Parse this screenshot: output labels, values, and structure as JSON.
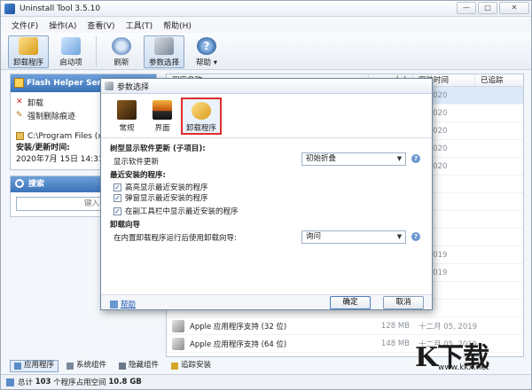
{
  "window": {
    "title": "Uninstall Tool 3.5.10",
    "buttons": {
      "minimize": "—",
      "maximize": "□",
      "close": "✕"
    }
  },
  "menu": [
    "文件(F)",
    "操作(A)",
    "查看(V)",
    "工具(T)",
    "帮助(H)"
  ],
  "toolbar": {
    "uninstall": "卸载程序",
    "startup": "启动项",
    "refresh": "刷新",
    "settings": "参数选择",
    "help": "帮助 ▾"
  },
  "left": {
    "title": "Flash Helper Service",
    "actions": {
      "uninstall": "卸载",
      "force_remove": "强制删除痕迹"
    },
    "path": "C:\\Program Files (x86)",
    "install_label": "安装/更新时间:",
    "install_date": "2020年7月 15日 14:31:19",
    "search_title": "搜索",
    "search_placeholder": "键入要查找的程序"
  },
  "list": {
    "headers": {
      "name": "程序名称",
      "size": "大小",
      "install_time": "安装时间",
      "tracked": "已追踪"
    },
    "rows": [
      {
        "name": "",
        "size": "",
        "date": "5, 2020"
      },
      {
        "name": "",
        "size": "",
        "date": "5, 2020"
      },
      {
        "name": "",
        "size": "",
        "date": "5, 2020"
      },
      {
        "name": "",
        "size": "",
        "date": "5, 2020"
      },
      {
        "name": "",
        "size": "",
        "date": "5, 2020"
      },
      {
        "name": "",
        "size": "",
        "date": ""
      },
      {
        "name": "",
        "size": "",
        "date": ""
      },
      {
        "name": "",
        "size": "",
        "date": ""
      },
      {
        "name": "",
        "size": "",
        "date": ""
      },
      {
        "name": "",
        "size": "",
        "date": "1, 2019"
      },
      {
        "name": "",
        "size": "",
        "date": "1, 2019"
      },
      {
        "name": "",
        "size": "",
        "date": ""
      },
      {
        "name": "",
        "size": "",
        "date": ""
      },
      {
        "name": "Apple 应用程序支持 (32 位)",
        "size": "128 MB",
        "date": "十二月 05, 2019"
      },
      {
        "name": "Apple 应用程序支持 (64 位)",
        "size": "148 MB",
        "date": "十二月 05, 2019"
      }
    ]
  },
  "bottom_tabs": [
    "应用程序",
    "系统组件",
    "隐藏组件",
    "追踪安装"
  ],
  "status": {
    "prefix": "总计",
    "count": "103",
    "middle": "个程序占用空间",
    "size": "10.8 GB"
  },
  "dialog": {
    "title": "参数选择",
    "tabs": {
      "general": "常规",
      "ui": "界面",
      "uninstaller": "卸载程序"
    },
    "tree_section": "树型显示软件更新 (子项目):",
    "show_updates_label": "显示软件更新",
    "show_updates_value": "初始折叠",
    "recent_section": "最近安装的程序:",
    "opt_highlight": "高亮显示最近安装的程序",
    "opt_popup": "弹窗显示最近安装的程序",
    "opt_sidebar": "在副工具栏中显示最近安装的程序",
    "wizard_section": "卸载向导",
    "wizard_label": "在内置卸载程序运行后使用卸载向导:",
    "wizard_value": "询问",
    "help": "帮助",
    "ok": "确定",
    "cancel": "取消"
  },
  "watermark": {
    "logo": "K下载",
    "url": "www.kkx.net"
  }
}
